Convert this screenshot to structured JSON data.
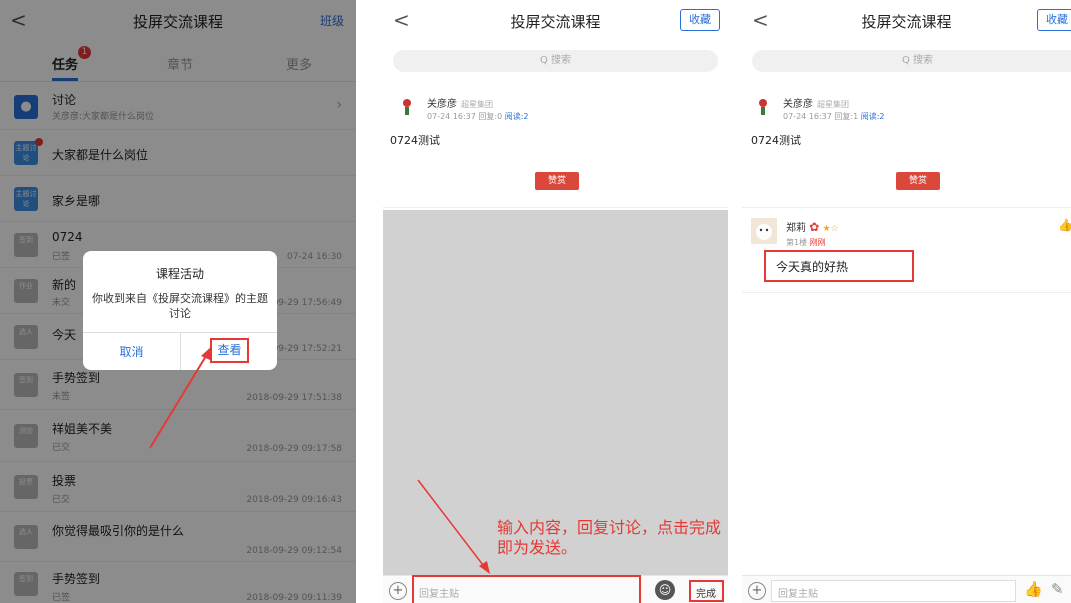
{
  "course_title": "投屏交流课程",
  "panel1": {
    "back": "<",
    "right_link": "班级",
    "tabs": [
      {
        "label": "任务",
        "badge": "1"
      },
      {
        "label": "章节"
      },
      {
        "label": "更多"
      }
    ],
    "rows": [
      {
        "icon": "discussion-icon",
        "title": "讨论",
        "sub": "关彦彦:大家都是什么岗位",
        "time": ""
      },
      {
        "icon_text": "主题讨论",
        "title": "大家都是什么岗位",
        "sub": "",
        "time": ""
      },
      {
        "icon_text": "主题讨论",
        "title": "家乡是哪",
        "sub": "",
        "time": ""
      },
      {
        "icon_text": "签到",
        "title": "0724",
        "sub": "已签",
        "time": "07-24 16:30"
      },
      {
        "icon_text": "作业",
        "title": "新的",
        "sub": "未交",
        "time": "09-29 17:56:49"
      },
      {
        "icon_text": "选人",
        "title": "今天",
        "sub": "",
        "time": "09-29 17:52:21"
      },
      {
        "icon_text": "签到",
        "title": "手势签到",
        "sub": "未签",
        "time": "2018-09-29 17:51:38"
      },
      {
        "icon_text": "测验",
        "title": "祥姐美不美",
        "sub": "已交",
        "time": "2018-09-29 09:17:58"
      },
      {
        "icon_text": "投票",
        "title": "投票",
        "sub": "已交",
        "time": "2018-09-29 09:16:43"
      },
      {
        "icon_text": "选人",
        "title": "你觉得最吸引你的是什么",
        "sub": "",
        "time": "2018-09-29 09:12:54"
      },
      {
        "icon_text": "签到",
        "title": "手势签到",
        "sub": "已签",
        "time": "2018-09-29 09:11:39"
      }
    ],
    "dialog": {
      "title": "课程活动",
      "message": "你收到来自《投屏交流课程》的主题讨论",
      "cancel": "取消",
      "view": "查看"
    }
  },
  "post": {
    "author": "关彦彦",
    "org": "超星集团",
    "meta_p2": "07-24 16:37  回复:0",
    "meta_p3": "07-24 16:37  回复:1",
    "read": "阅读:2",
    "body": "0724测试",
    "reward": "赞赏"
  },
  "panel2": {
    "back": "<",
    "collect": "收藏",
    "search_placeholder": "Q 搜索",
    "reply_placeholder": "回复主贴",
    "done": "完成",
    "annotation": "输入内容，回复讨论，点击完成即为发送。"
  },
  "panel3": {
    "back": "<",
    "collect": "收藏",
    "search_placeholder": "Q 搜索",
    "reply_placeholder": "回复主贴",
    "reply": {
      "name": "郑莉",
      "floor": "第1楼",
      "when": "刚刚",
      "content": "今天真的好热"
    }
  },
  "colors": {
    "accent": "#2a6fd8",
    "alert": "#e53935",
    "reward": "#d9483b"
  }
}
